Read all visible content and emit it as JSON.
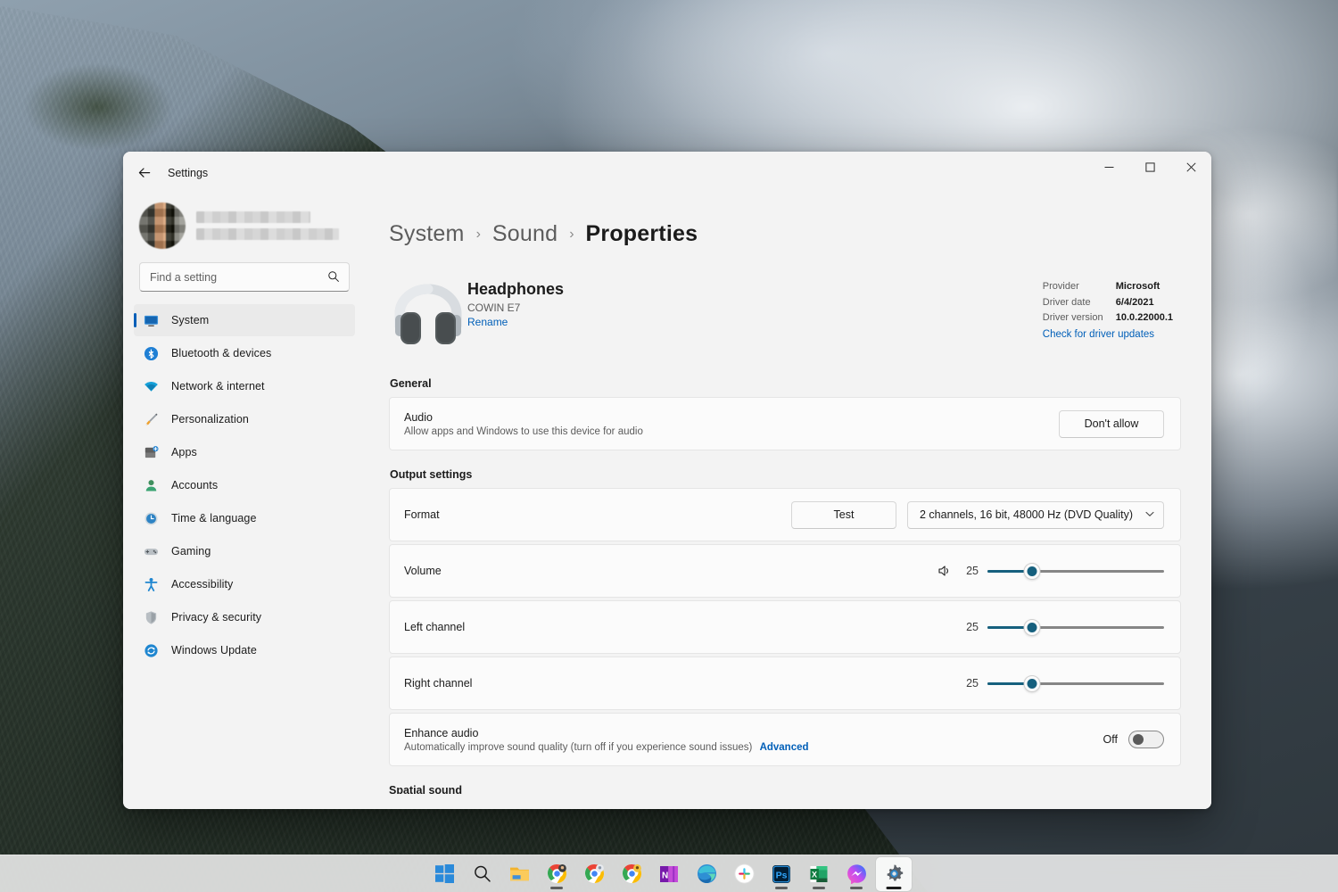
{
  "window": {
    "app_title": "Settings",
    "back_icon": "back-arrow-icon",
    "minimize_label": "‒",
    "maximize_label": "□",
    "close_label": "✕"
  },
  "sidebar": {
    "profile": {
      "name_redacted": true,
      "avatar_redacted": true
    },
    "search": {
      "placeholder": "Find a setting",
      "value": "",
      "icon": "search-icon"
    },
    "items": [
      {
        "label": "System",
        "icon": "display-icon",
        "active": true
      },
      {
        "label": "Bluetooth & devices",
        "icon": "bluetooth-icon",
        "active": false
      },
      {
        "label": "Network & internet",
        "icon": "wifi-icon",
        "active": false
      },
      {
        "label": "Personalization",
        "icon": "paintbrush-icon",
        "active": false
      },
      {
        "label": "Apps",
        "icon": "apps-icon",
        "active": false
      },
      {
        "label": "Accounts",
        "icon": "person-icon",
        "active": false
      },
      {
        "label": "Time & language",
        "icon": "clock-icon",
        "active": false
      },
      {
        "label": "Gaming",
        "icon": "gamepad-icon",
        "active": false
      },
      {
        "label": "Accessibility",
        "icon": "accessibility-icon",
        "active": false
      },
      {
        "label": "Privacy & security",
        "icon": "shield-icon",
        "active": false
      },
      {
        "label": "Windows Update",
        "icon": "update-icon",
        "active": false
      }
    ]
  },
  "breadcrumb": {
    "root": "System",
    "sep": "›",
    "mid": "Sound",
    "current": "Properties"
  },
  "device": {
    "icon": "headphones-icon",
    "name": "Headphones",
    "model": "COWIN E7",
    "rename_label": "Rename"
  },
  "driver": {
    "provider_key": "Provider",
    "provider_value": "Microsoft",
    "date_key": "Driver date",
    "date_value": "6/4/2021",
    "version_key": "Driver version",
    "version_value": "10.0.22000.1",
    "updates_link": "Check for driver updates"
  },
  "general": {
    "heading": "General",
    "audio": {
      "title": "Audio",
      "subtitle": "Allow apps and Windows to use this device for audio",
      "button_label": "Don't allow"
    }
  },
  "output": {
    "heading": "Output settings",
    "format": {
      "label": "Format",
      "test_button": "Test",
      "value": "2 channels, 16 bit, 48000 Hz (DVD Quality)",
      "chevron": "chevron-down-icon"
    },
    "volume": {
      "label": "Volume",
      "speaker_icon": "speaker-icon",
      "value": "25",
      "percent": 25
    },
    "left_channel": {
      "label": "Left channel",
      "value": "25",
      "percent": 25
    },
    "right_channel": {
      "label": "Right channel",
      "value": "25",
      "percent": 25
    },
    "enhance_audio": {
      "title": "Enhance audio",
      "subtitle": "Automatically improve sound quality (turn off if you experience sound issues)",
      "advanced_link": "Advanced",
      "toggle_state_label": "Off",
      "toggle_on": false
    }
  },
  "below_fold": {
    "next_heading": "Spatial sound"
  },
  "taskbar": {
    "items": [
      {
        "name": "start-button",
        "icon": "windows-logo-icon",
        "running": false,
        "active": false
      },
      {
        "name": "search-button",
        "icon": "search-icon",
        "running": false,
        "active": false
      },
      {
        "name": "file-explorer",
        "icon": "folder-icon",
        "running": false,
        "active": false
      },
      {
        "name": "chrome-profile-1",
        "icon": "chrome-icon",
        "running": true,
        "active": false
      },
      {
        "name": "chrome-profile-2",
        "icon": "chrome-icon",
        "running": false,
        "active": false
      },
      {
        "name": "chrome-profile-3",
        "icon": "chrome-icon",
        "running": false,
        "active": false
      },
      {
        "name": "onenote",
        "icon": "onenote-icon",
        "running": false,
        "active": false
      },
      {
        "name": "microsoft-edge",
        "icon": "edge-icon",
        "running": false,
        "active": false
      },
      {
        "name": "slack",
        "icon": "slack-icon",
        "running": false,
        "active": false
      },
      {
        "name": "photoshop",
        "icon": "photoshop-icon",
        "running": true,
        "active": false
      },
      {
        "name": "excel",
        "icon": "excel-icon",
        "running": true,
        "active": false
      },
      {
        "name": "messenger",
        "icon": "messenger-icon",
        "running": true,
        "active": false
      },
      {
        "name": "settings",
        "icon": "gear-icon",
        "running": true,
        "active": true
      }
    ]
  },
  "colors": {
    "accent": "#005fb8",
    "slider_fill": "#16607e",
    "link": "#005fb8",
    "window_bg": "#f3f3f3",
    "card_bg": "#fbfbfb"
  }
}
